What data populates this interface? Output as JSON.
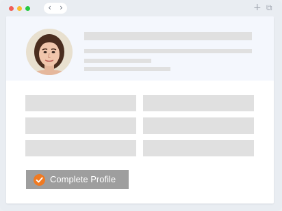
{
  "titlebar": {
    "dots": [
      "#f05f57",
      "#fbbd2e",
      "#28c941"
    ],
    "back_glyph": "‹",
    "forward_glyph": "›",
    "new_tab_glyph": "+",
    "duplicate_glyph": "⧉"
  },
  "profile": {
    "avatar_icon": "woman-portrait",
    "skeleton_color": "#e0e0e0",
    "header_bg": "#f4f7fd"
  },
  "cta": {
    "label": "Complete Profile",
    "icon": "check-circle-icon",
    "bg_color": "#9e9e9e",
    "icon_color": "#f07a22"
  }
}
